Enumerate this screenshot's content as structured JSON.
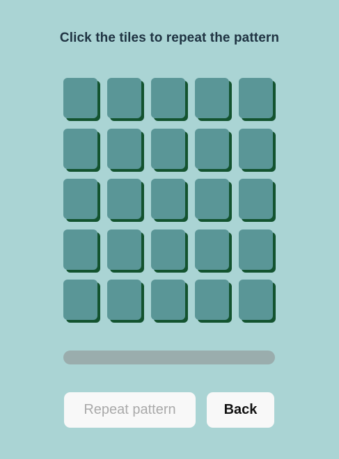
{
  "game": {
    "instruction": "Click the tiles to repeat the pattern",
    "grid": {
      "rows": 5,
      "columns": 5
    },
    "progress": 0,
    "colors": {
      "background": "#aad4d4",
      "tile": "#5a9697",
      "tile_shadow": "#13532f",
      "progress_track": "#9aadad"
    }
  },
  "buttons": {
    "repeat_label": "Repeat pattern",
    "repeat_disabled": true,
    "back_label": "Back"
  }
}
